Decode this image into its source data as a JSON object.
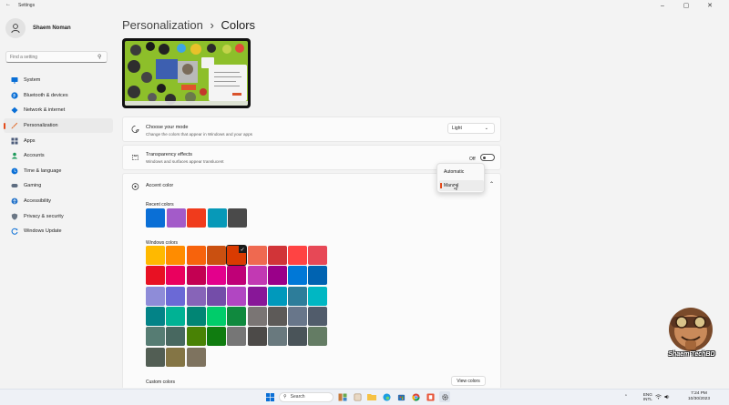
{
  "window": {
    "title": "Settings",
    "back_icon": "back-arrow-icon",
    "controls": [
      "minimize",
      "maximize",
      "close"
    ]
  },
  "profile": {
    "name": "Shaem Noman"
  },
  "search": {
    "placeholder": "Find a setting"
  },
  "sidebar": {
    "items": [
      {
        "label": "System",
        "icon": "monitor-icon",
        "color": "#0a6fd6"
      },
      {
        "label": "Bluetooth & devices",
        "icon": "bluetooth-icon",
        "color": "#0a6fd6"
      },
      {
        "label": "Network & internet",
        "icon": "wifi-icon",
        "color": "#0a6fd6"
      },
      {
        "label": "Personalization",
        "icon": "brush-icon",
        "color": "#e06b2a",
        "active": true
      },
      {
        "label": "Apps",
        "icon": "apps-icon",
        "color": "#4a5a78"
      },
      {
        "label": "Accounts",
        "icon": "person-icon",
        "color": "#1e9b5b"
      },
      {
        "label": "Time & language",
        "icon": "globe-clock-icon",
        "color": "#0a6fd6"
      },
      {
        "label": "Gaming",
        "icon": "gamepad-icon",
        "color": "#5d6c80"
      },
      {
        "label": "Accessibility",
        "icon": "accessibility-icon",
        "color": "#2272c9"
      },
      {
        "label": "Privacy & security",
        "icon": "shield-icon",
        "color": "#6b7785"
      },
      {
        "label": "Windows Update",
        "icon": "update-icon",
        "color": "#0a6fd6"
      }
    ]
  },
  "header": {
    "crumb": "Personalization",
    "separator": "›",
    "title": "Colors"
  },
  "mode": {
    "title": "Choose your mode",
    "desc": "Change the colors that appear in Windows and your apps",
    "value": "Light"
  },
  "transparency": {
    "title": "Transparency effects",
    "desc": "Windows and surfaces appear translucent",
    "state": "Off"
  },
  "accent": {
    "title": "Accent color",
    "menu_options": [
      "Automatic",
      "Manual"
    ],
    "selected_option": "Manual",
    "recent_label": "Recent colors",
    "recent_colors": [
      "#0a6fd6",
      "#a35bc9",
      "#f03b1c",
      "#0799b8",
      "#4a4a4a"
    ],
    "windows_label": "Windows colors",
    "windows_colors": [
      [
        "#ffb900",
        "#ff8c00",
        "#f7630c",
        "#ca5010",
        "#da3b01",
        "#ef6950",
        "#d13438",
        "#ff4343",
        "#e74856"
      ],
      [
        "#e81123",
        "#ea005e",
        "#c30052",
        "#e3008c",
        "#bf0077",
        "#c239b3",
        "#9a0089",
        "#0078d7",
        "#0063b1"
      ],
      [
        "#8e8cd8",
        "#6b69d6",
        "#8764b8",
        "#744da9",
        "#b146c2",
        "#881798",
        "#0099bc",
        "#2d7d9a",
        "#00b7c3"
      ],
      [
        "#038387",
        "#00b294",
        "#018574",
        "#00cc6a",
        "#10893e",
        "#7a7574",
        "#5d5a58",
        "#68768a",
        "#515c6b"
      ],
      [
        "#567c73",
        "#486860",
        "#498205",
        "#107c10",
        "#767676",
        "#4c4a48",
        "#69797e",
        "#4a5459",
        "#647c64"
      ],
      [
        "#525e54",
        "#847545",
        "#7e735f"
      ]
    ],
    "selected_color": "#da3b01",
    "custom_label": "Custom colors",
    "view_colors": "View colors"
  },
  "taskbar": {
    "search_placeholder": "Search",
    "lang_top": "ENG",
    "lang_bottom": "INTL",
    "time": "7:24 PM",
    "date": "10/30/2023"
  },
  "watermark": {
    "text": "Shaem TechBD"
  }
}
